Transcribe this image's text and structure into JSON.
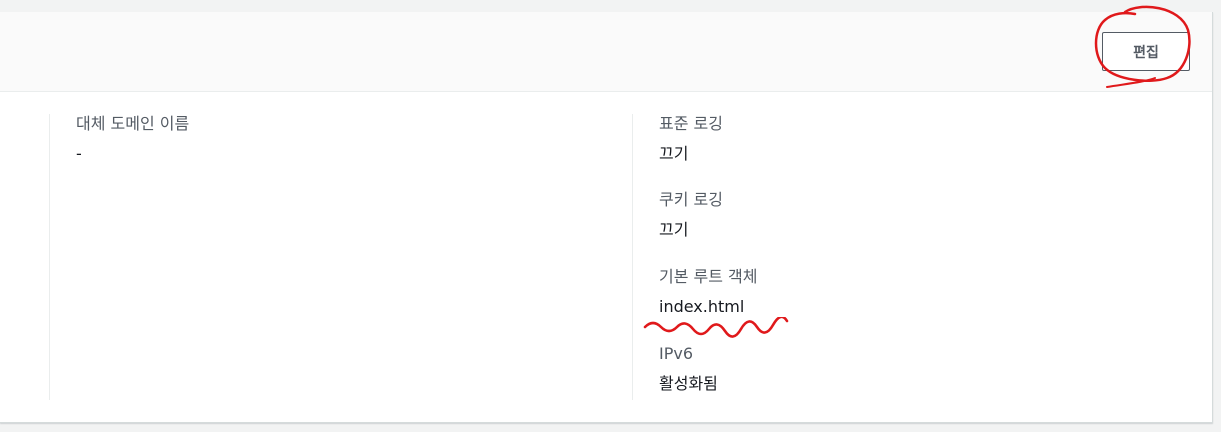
{
  "header": {
    "edit_label": "편집"
  },
  "left_column": {
    "alt_domain_label": "대체 도메인 이름",
    "alt_domain_value": "-"
  },
  "right_column": {
    "standard_logging_label": "표준 로깅",
    "standard_logging_value": "끄기",
    "cookie_logging_label": "쿠키 로깅",
    "cookie_logging_value": "끄기",
    "default_root_label": "기본 루트 객체",
    "default_root_value": "index.html",
    "ipv6_label": "IPv6",
    "ipv6_value": "활성화됨"
  },
  "colors": {
    "annotation_red": "#e0191b",
    "label_gray": "#545b64",
    "value_black": "#16191f"
  }
}
